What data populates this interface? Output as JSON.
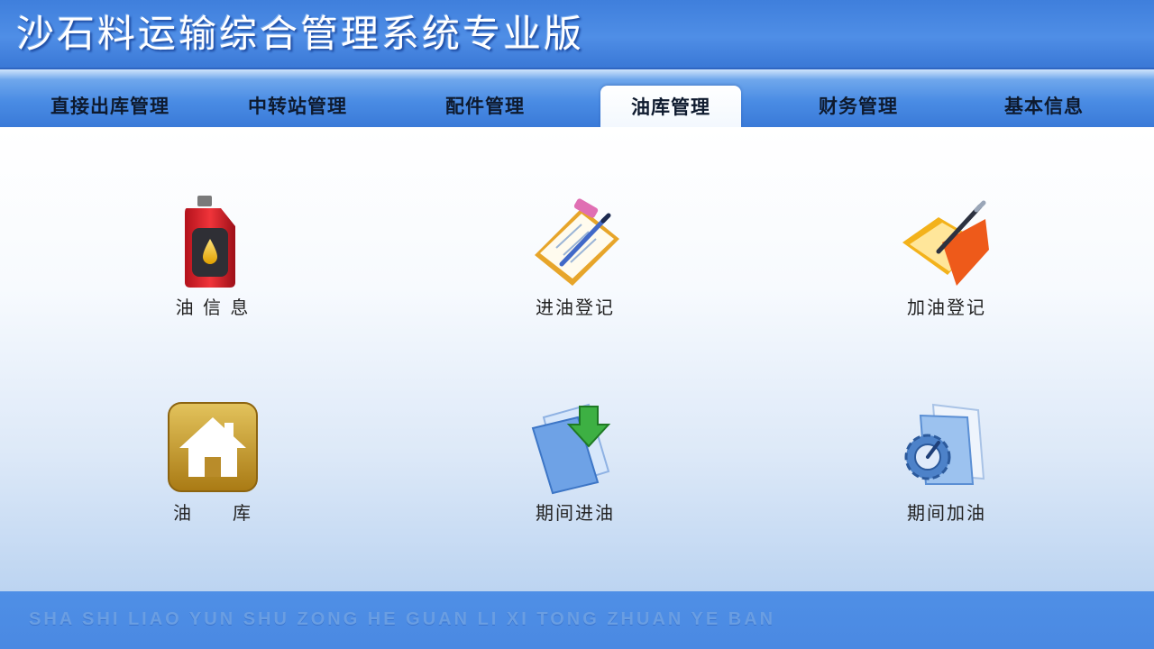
{
  "app": {
    "title": "沙石料运输综合管理系统专业版",
    "footer_pinyin": "SHA SHI LIAO YUN SHU ZONG HE GUAN LI XI TONG ZHUAN YE BAN"
  },
  "tabs": [
    {
      "label": "直接出库管理",
      "active": false
    },
    {
      "label": "中转站管理",
      "active": false
    },
    {
      "label": "配件管理",
      "active": false
    },
    {
      "label": "油库管理",
      "active": true
    },
    {
      "label": "财务管理",
      "active": false
    },
    {
      "label": "基本信息",
      "active": false
    }
  ],
  "tiles": [
    {
      "label": "油 信 息",
      "icon": "oil-can-icon"
    },
    {
      "label": "进油登记",
      "icon": "clipboard-pen-icon"
    },
    {
      "label": "加油登记",
      "icon": "folder-pen-icon"
    },
    {
      "label": "油　　库",
      "icon": "house-icon"
    },
    {
      "label": "期间进油",
      "icon": "document-download-icon"
    },
    {
      "label": "期间加油",
      "icon": "document-gear-icon"
    }
  ],
  "colors": {
    "header_blue": "#4f8ee6",
    "footer_blue": "#4a89e2",
    "content_top": "#ffffff",
    "content_bottom": "#bcd4f1"
  }
}
